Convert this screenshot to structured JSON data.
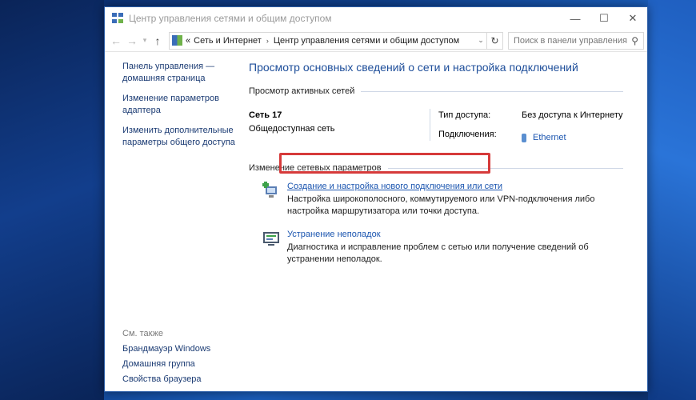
{
  "window": {
    "title": "Центр управления сетями и общим доступом",
    "controls": {
      "minimize": "—",
      "maximize": "☐",
      "close": "✕"
    }
  },
  "address": {
    "prefix": "«",
    "crumbs": [
      "Сеть и Интернет",
      "Центр управления сетями и общим доступом"
    ],
    "separator": "›",
    "search_placeholder": "Поиск в панели управления"
  },
  "sidebar": {
    "links": [
      "Панель управления — домашняя страница",
      "Изменение параметров адаптера",
      "Изменить дополнительные параметры общего доступа"
    ],
    "see_also_title": "См. также",
    "see_also": [
      "Брандмауэр Windows",
      "Домашняя группа",
      "Свойства браузера"
    ]
  },
  "main": {
    "title": "Просмотр основных сведений о сети и настройка подключений",
    "active_networks_heading": "Просмотр активных сетей",
    "network": {
      "name": "Сеть  17",
      "type": "Общедоступная сеть",
      "access_label": "Тип доступа:",
      "access_value": "Без доступа к Интернету",
      "connections_label": "Подключения:",
      "connections_value": "Ethernet"
    },
    "change_heading": "Изменение сетевых параметров",
    "tasks": [
      {
        "link": "Создание и настройка нового подключения или сети",
        "desc": "Настройка широкополосного, коммутируемого или VPN-подключения либо настройка маршрутизатора или точки доступа."
      },
      {
        "link": "Устранение неполадок",
        "desc": "Диагностика и исправление проблем с сетью или получение сведений об устранении неполадок."
      }
    ]
  },
  "colors": {
    "highlight": "#d63a3a",
    "link": "#1c56b0",
    "title": "#1e4e9a"
  }
}
